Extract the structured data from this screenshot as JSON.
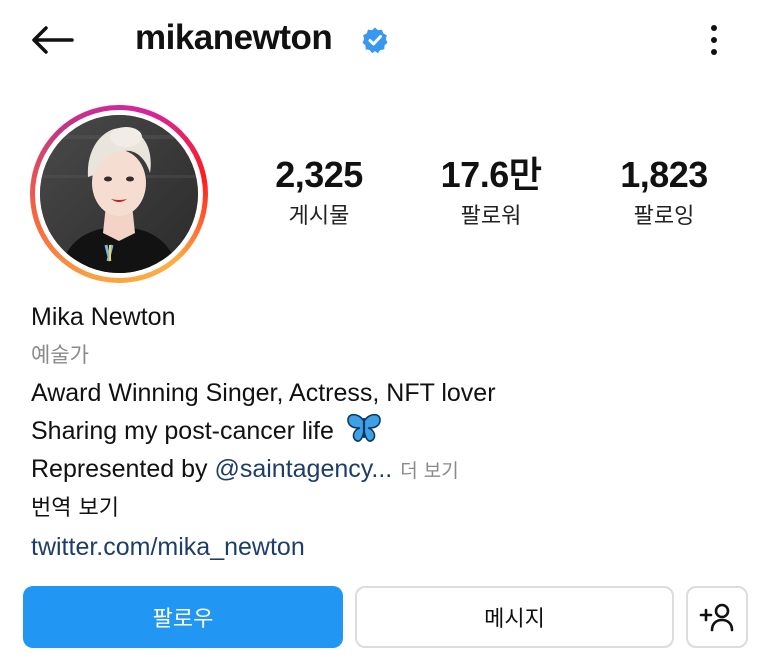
{
  "header": {
    "back_icon": "arrow-left-icon",
    "username": "mikanewton",
    "verified_icon": "verified-badge-icon",
    "more_icon": "vertical-dots-icon"
  },
  "stats": {
    "posts": {
      "value": "2,325",
      "label": "게시물"
    },
    "followers": {
      "value": "17.6만",
      "label": "팔로워"
    },
    "following": {
      "value": "1,823",
      "label": "팔로잉"
    }
  },
  "bio": {
    "name": "Mika Newton",
    "category": "예술가",
    "line1": "Award Winning Singer, Actress, NFT lover",
    "line2": "Sharing my post-cancer life",
    "line2_emoji_icon": "butterfly-icon",
    "line3_prefix": "Represented by ",
    "line3_mention": "@saintagency...",
    "more_link": "더 보기",
    "translate": "번역 보기",
    "website": "twitter.com/mika_newton"
  },
  "actions": {
    "follow_label": "팔로우",
    "message_label": "메시지",
    "add_user_icon": "person-add-icon"
  },
  "colors": {
    "follow_button": "#2196f3",
    "link": "#1d3e68",
    "verified": "#3897f0",
    "muted_text": "#8a8a8a"
  }
}
